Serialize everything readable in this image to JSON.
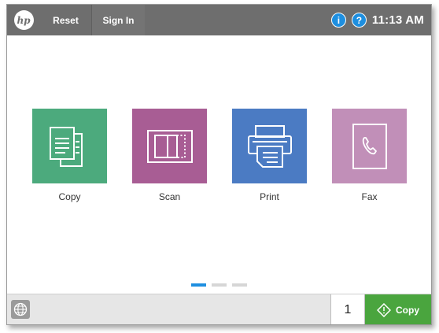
{
  "topbar": {
    "logo_text": "hp",
    "reset_label": "Reset",
    "signin_label": "Sign In",
    "info_icon_text": "i",
    "help_icon_text": "?",
    "time": "11:13 AM",
    "bg_color": "#6e6e6e",
    "icon_color": "#1e8fe0"
  },
  "apps": [
    {
      "label": "Copy",
      "icon": "copy-icon",
      "color": "#4caa7d"
    },
    {
      "label": "Scan",
      "icon": "scan-icon",
      "color": "#a85d94"
    },
    {
      "label": "Print",
      "icon": "print-icon",
      "color": "#4b7bc3"
    },
    {
      "label": "Fax",
      "icon": "fax-icon",
      "color": "#c18fb8"
    }
  ],
  "pagination": {
    "pages": 3,
    "current": 1
  },
  "bottombar": {
    "language_icon": "globe-icon",
    "copies_value": "1",
    "start_label": "Copy",
    "start_color": "#4aa53e"
  }
}
